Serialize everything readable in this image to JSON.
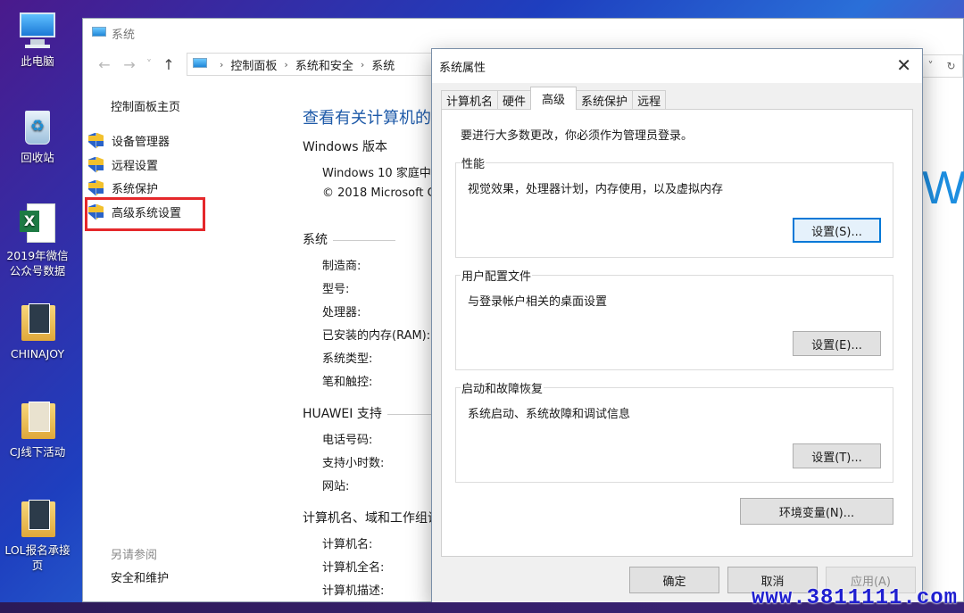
{
  "desktop": {
    "icons": [
      {
        "label": "此电脑"
      },
      {
        "label": "回收站"
      },
      {
        "label": "2019年微信公众号数据"
      },
      {
        "label": "CHINAJOY"
      },
      {
        "label": "CJ线下活动"
      },
      {
        "label": "LOL报名承接页"
      }
    ]
  },
  "system_window": {
    "title": "系统",
    "nav": {
      "back": "←",
      "forward": "→",
      "recent": "˅",
      "up": "↑"
    },
    "breadcrumb": [
      "控制面板",
      "系统和安全",
      "系统"
    ],
    "left_pane": {
      "home": "控制面板主页",
      "items": [
        "设备管理器",
        "远程设置",
        "系统保护",
        "高级系统设置"
      ],
      "see_also": "另请参阅",
      "security": "安全和维护"
    },
    "main": {
      "title": "查看有关计算机的基",
      "windows_section": "Windows 版本",
      "windows_edition": "Windows 10 家庭中",
      "copyright": "© 2018 Microsoft C",
      "system_section": "系统",
      "system_rows": [
        "制造商:",
        "型号:",
        "处理器:",
        "已安装的内存(RAM):",
        "系统类型:",
        "笔和触控:"
      ],
      "huawei_section": "HUAWEI 支持",
      "huawei_rows": [
        "电话号码:",
        "支持小时数:",
        "网站:"
      ],
      "computer_section": "计算机名、域和工作组设",
      "computer_rows": [
        "计算机名:",
        "计算机全名:",
        "计算机描述:"
      ],
      "logo_text": "W"
    }
  },
  "dialog": {
    "title": "系统属性",
    "close": "✕",
    "tabs": [
      "计算机名",
      "硬件",
      "高级",
      "系统保护",
      "远程"
    ],
    "active_tab": "高级",
    "note": "要进行大多数更改，你必须作为管理员登录。",
    "performance": {
      "label": "性能",
      "desc": "视觉效果，处理器计划，内存使用，以及虚拟内存",
      "button": "设置(S)..."
    },
    "user_profiles": {
      "label": "用户配置文件",
      "desc": "与登录帐户相关的桌面设置",
      "button": "设置(E)..."
    },
    "startup": {
      "label": "启动和故障恢复",
      "desc": "系统启动、系统故障和调试信息",
      "button": "设置(T)..."
    },
    "env_button": "环境变量(N)...",
    "ok": "确定",
    "cancel": "取消",
    "apply": "应用(A)"
  },
  "watermark": "www.3811111.com",
  "colors": {
    "accent": "#0078d7",
    "link_title": "#1e5aa8",
    "highlight_box": "#e5282b",
    "watermark": "#1f1fd0"
  }
}
